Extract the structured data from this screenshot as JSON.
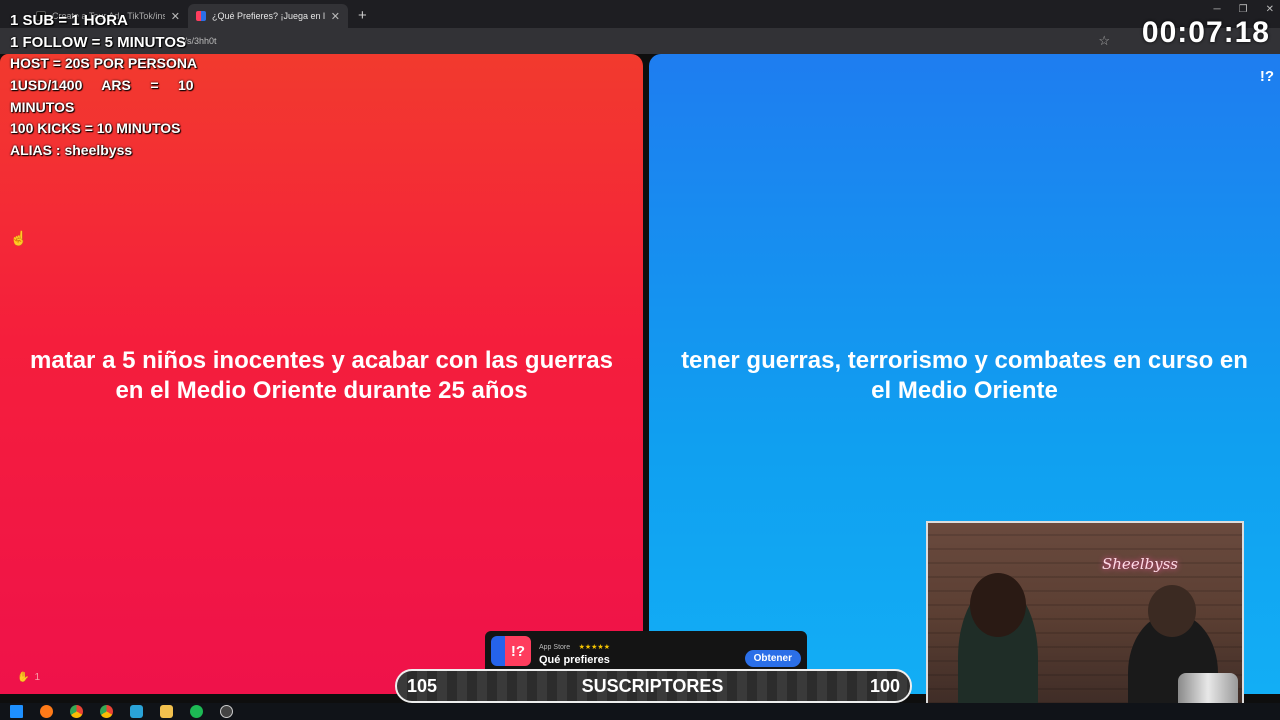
{
  "browser": {
    "tabs": [
      {
        "title": "Create a Tour Ad - TikTok/insta Arg",
        "active": false
      },
      {
        "title": "¿Qué Prefieres? ¡Juega en línea!",
        "active": true
      }
    ],
    "new_tab": "+",
    "url_fragment": "s/s/3hh0t"
  },
  "overlay": {
    "lines": [
      "1 SUB = 1 HORA",
      "1 FOLLOW = 5 MINUTOS",
      "HOST = 20S POR PERSONA",
      "1USD/1400     ARS     =     10",
      "MINUTOS",
      "100 KICKS = 10 MINUTOS",
      "ALIAS : sheelbyss"
    ],
    "timer": "00:07:18"
  },
  "game": {
    "left_option": "matar a 5 niños inocentes y acabar con las guerras en el Medio Oriente durante 25 años",
    "right_option": "tener guerras, terrorismo y combates en curso en el Medio Oriente",
    "help_icon": "!?",
    "likes": "1",
    "colors": {
      "left": "#f3213f",
      "right": "#14a3f2"
    }
  },
  "ad": {
    "store": "App Store",
    "stars": "★★★★★",
    "app_name": "Qué prefieres",
    "button": "Obtener"
  },
  "goal": {
    "current": "105",
    "label": "SUSCRIPTORES",
    "target": "100"
  },
  "webcam": {
    "neon_sign": "Sheelbyss"
  },
  "icons": [
    "windows-start-icon",
    "firefox-icon",
    "chrome-icon",
    "chrome-icon",
    "files-icon",
    "folder-icon",
    "spotify-icon",
    "obs-icon"
  ]
}
